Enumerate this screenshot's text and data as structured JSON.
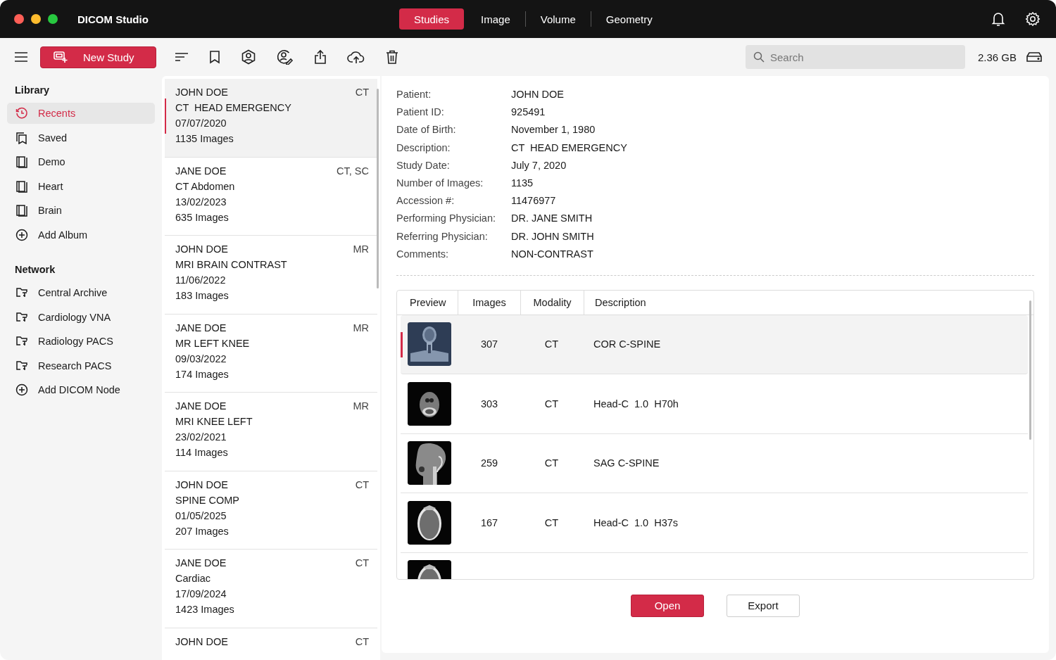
{
  "window": {
    "title": "DICOM Studio"
  },
  "modes": [
    {
      "label": "Studies",
      "selected": true
    },
    {
      "label": "Image",
      "selected": false
    },
    {
      "label": "Volume",
      "selected": false
    },
    {
      "label": "Geometry",
      "selected": false
    }
  ],
  "toolbar": {
    "new_study": "New Study",
    "search": {
      "placeholder": "Search"
    },
    "storage": "2.36 GB"
  },
  "sidebar": {
    "sections": [
      {
        "title": "Library",
        "items": [
          {
            "label": "Recents",
            "kind": "recent",
            "selected": true
          },
          {
            "label": "Saved",
            "kind": "saved",
            "selected": false
          },
          {
            "label": "Demo",
            "kind": "album",
            "selected": false
          },
          {
            "label": "Heart",
            "kind": "album",
            "selected": false
          },
          {
            "label": "Brain",
            "kind": "album",
            "selected": false
          },
          {
            "label": "Add Album",
            "kind": "add",
            "selected": false
          }
        ]
      },
      {
        "title": "Network",
        "items": [
          {
            "label": "Central Archive",
            "kind": "node",
            "selected": false
          },
          {
            "label": "Cardiology VNA",
            "kind": "node",
            "selected": false
          },
          {
            "label": "Radiology PACS",
            "kind": "node",
            "selected": false
          },
          {
            "label": "Research PACS",
            "kind": "node",
            "selected": false
          },
          {
            "label": "Add DICOM Node",
            "kind": "add",
            "selected": false
          }
        ]
      }
    ]
  },
  "studies": [
    {
      "patient": "JOHN DOE",
      "modality": "CT",
      "description": "CT  HEAD EMERGENCY",
      "date": "07/07/2020",
      "images": "1135 Images",
      "selected": true
    },
    {
      "patient": "JANE DOE",
      "modality": "CT, SC",
      "description": "CT Abdomen",
      "date": "13/02/2023",
      "images": "635 Images",
      "selected": false
    },
    {
      "patient": "JOHN DOE",
      "modality": "MR",
      "description": "MRI BRAIN CONTRAST",
      "date": "11/06/2022",
      "images": "183 Images",
      "selected": false
    },
    {
      "patient": "JANE DOE",
      "modality": "MR",
      "description": "MR LEFT KNEE",
      "date": "09/03/2022",
      "images": "174 Images",
      "selected": false
    },
    {
      "patient": "JANE DOE",
      "modality": "MR",
      "description": "MRI KNEE LEFT",
      "date": "23/02/2021",
      "images": "114 Images",
      "selected": false
    },
    {
      "patient": "JOHN DOE",
      "modality": "CT",
      "description": "SPINE COMP",
      "date": "01/05/2025",
      "images": "207 Images",
      "selected": false
    },
    {
      "patient": "JANE DOE",
      "modality": "CT",
      "description": "Cardiac",
      "date": "17/09/2024",
      "images": "1423 Images",
      "selected": false
    },
    {
      "patient": "JOHN DOE",
      "modality": "CT",
      "selected": false
    }
  ],
  "details": [
    {
      "label": "Patient:",
      "value": "JOHN DOE"
    },
    {
      "label": "Patient ID:",
      "value": "925491"
    },
    {
      "label": "Date of Birth:",
      "value": "November 1, 1980"
    },
    {
      "label": "Description:",
      "value": "CT  HEAD EMERGENCY"
    },
    {
      "label": "Study Date:",
      "value": "July 7, 2020"
    },
    {
      "label": "Number of Images:",
      "value": "1135"
    },
    {
      "label": "Accession #:",
      "value": "11476977"
    },
    {
      "label": "Performing Physician:",
      "value": "DR. JANE SMITH"
    },
    {
      "label": "Referring Physician:",
      "value": "DR. JOHN SMITH"
    },
    {
      "label": "Comments:",
      "value": "NON-CONTRAST"
    }
  ],
  "series_table": {
    "columns": [
      "Preview",
      "Images",
      "Modality",
      "Description"
    ],
    "rows": [
      {
        "images": "307",
        "modality": "CT",
        "description": "COR C-SPINE",
        "selected": true
      },
      {
        "images": "303",
        "modality": "CT",
        "description": "Head-C  1.0  H70h",
        "selected": false
      },
      {
        "images": "259",
        "modality": "CT",
        "description": "SAG C-SPINE",
        "selected": false
      },
      {
        "images": "167",
        "modality": "CT",
        "description": "Head-C  1.0  H37s",
        "selected": false
      },
      {
        "selected": false
      }
    ]
  },
  "buttons": {
    "open": "Open",
    "export": "Export"
  }
}
